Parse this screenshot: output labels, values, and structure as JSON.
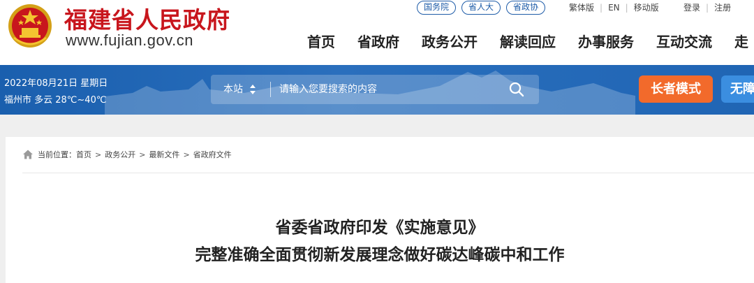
{
  "header": {
    "site_name": "福建省人民政府",
    "site_url": "www.fujian.gov.cn",
    "external_links": [
      "国务院",
      "省人大",
      "省政协"
    ],
    "lang_links": [
      "繁体版",
      "EN",
      "移动版"
    ],
    "user_links": [
      "登录",
      "注册"
    ],
    "nav": [
      "首页",
      "省政府",
      "政务公开",
      "解读回应",
      "办事服务",
      "互动交流",
      "走"
    ]
  },
  "band": {
    "date": "2022年08月21日 星期日",
    "weather": "福州市 多云 28℃~40℃",
    "search_scope": "本站",
    "search_placeholder": "请输入您要搜索的内容",
    "elder_mode": "长者模式",
    "accessible_mode": "无障"
  },
  "breadcrumb": {
    "prefix": "当前位置：",
    "items": [
      "首页",
      "政务公开",
      "最新文件",
      "省政府文件"
    ],
    "separator": ">"
  },
  "article": {
    "title_line1": "省委省政府印发《实施意见》",
    "title_line2": "完整准确全面贯彻新发展理念做好碳达峰碳中和工作"
  },
  "colors": {
    "brand_red": "#c8161d",
    "band_blue": "#2065b4",
    "elder_orange": "#f26a2b",
    "link_blue": "#1e5ca8"
  },
  "icons": {
    "emblem": "national-emblem-icon",
    "scope_toggle": "sort-arrows-icon",
    "search": "search-icon",
    "home": "home-icon"
  }
}
